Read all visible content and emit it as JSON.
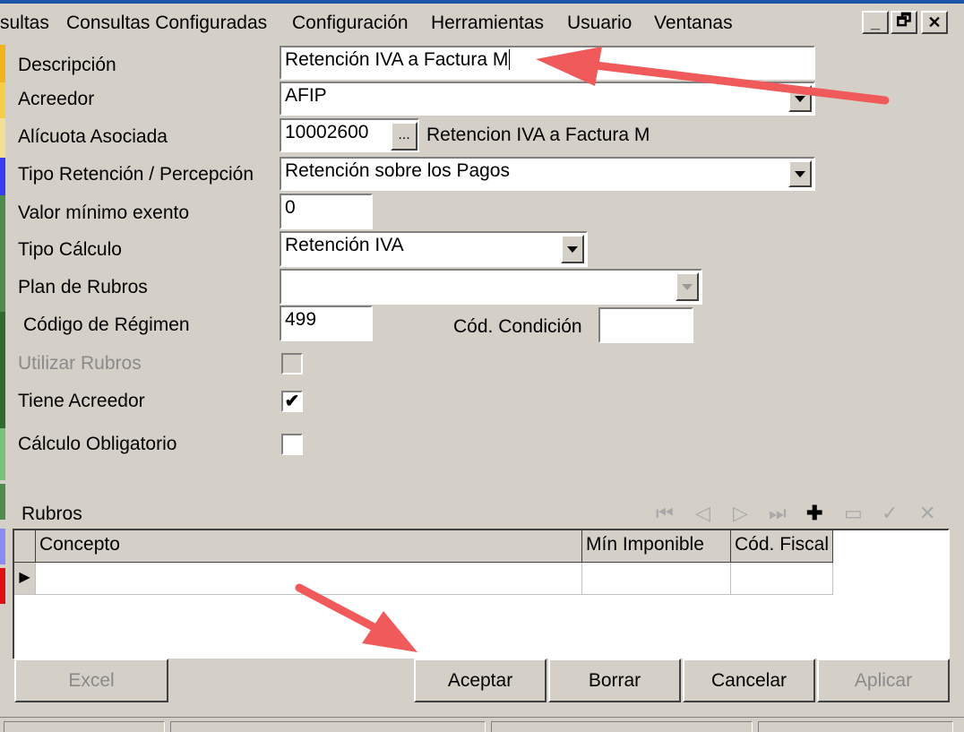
{
  "menu": {
    "items": [
      "sultas",
      "Consultas Configuradas",
      "Configuración",
      "Herramientas",
      "Usuario",
      "Ventanas"
    ],
    "window_buttons": [
      "_",
      "🗗",
      "✕"
    ]
  },
  "form": {
    "descripcion": {
      "label": "Descripción",
      "value": "Retención IVA a Factura M"
    },
    "acreedor": {
      "label": "Acreedor",
      "value": "AFIP"
    },
    "alicuota": {
      "label": "Alícuota Asociada",
      "code": "10002600",
      "button": "...",
      "description": "Retencion IVA a Factura M"
    },
    "tipo_retencion": {
      "label": "Tipo Retención / Percepción",
      "value": "Retención sobre los Pagos"
    },
    "valor_minimo": {
      "label": "Valor mínimo exento",
      "value": "0"
    },
    "tipo_calculo": {
      "label": "Tipo Cálculo",
      "value": "Retención IVA"
    },
    "plan_rubros": {
      "label": "Plan de Rubros",
      "value": ""
    },
    "codigo_regimen": {
      "label": "Código de Régimen",
      "value": "499"
    },
    "cod_condicion": {
      "label": "Cód. Condición",
      "value": ""
    },
    "utilizar_rubros": {
      "label": "Utilizar Rubros",
      "checked": false
    },
    "tiene_acreedor": {
      "label": "Tiene Acreedor",
      "checked": true,
      "mark": "✔"
    },
    "calculo_obligatorio": {
      "label": "Cálculo Obligatorio",
      "checked": false
    }
  },
  "rubros": {
    "title": "Rubros",
    "columns": [
      "Concepto",
      "Mín Imponible",
      "Cód. Fiscal"
    ],
    "nav_icons": [
      "first-icon",
      "prev-icon",
      "next-icon",
      "last-icon",
      "add-icon",
      "remove-icon",
      "confirm-icon",
      "cancel-icon"
    ],
    "row_indicator": "▶"
  },
  "buttons": {
    "excel": "Excel",
    "aceptar": "Aceptar",
    "borrar": "Borrar",
    "cancelar": "Cancelar",
    "aplicar": "Aplicar"
  },
  "colors": {
    "annotation_arrow": "#f05a5a",
    "title_strip": "#1c56a8"
  }
}
